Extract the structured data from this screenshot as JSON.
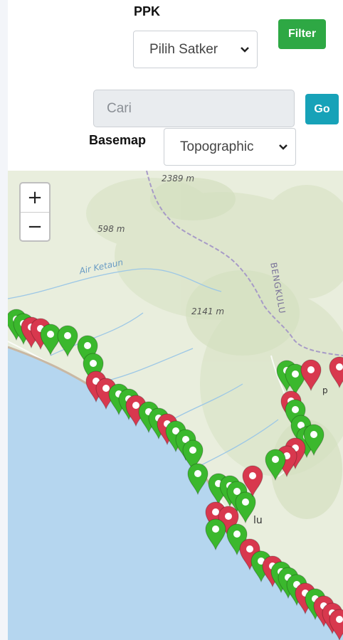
{
  "filter": {
    "ppk_label": "PPK",
    "satker_select_value": "Pilih Satker",
    "filter_button": "Filter"
  },
  "search": {
    "placeholder": "Cari",
    "go_button": "Go"
  },
  "basemap": {
    "label": "Basemap",
    "selected": "Topographic"
  },
  "map": {
    "zoom_in": "+",
    "zoom_out": "−",
    "labels": {
      "elev_1": "2389 m",
      "elev_2": "598 m",
      "elev_3": "2141 m",
      "river": "Air Ketaun",
      "province": "BENGKULU",
      "town_partial_1": "p",
      "town_partial_2": "lu"
    },
    "marker_colors": {
      "green": "#3bb82d",
      "red": "#d8384e"
    }
  },
  "colors": {
    "filter_button": "#2ea844",
    "go_button": "#17a2b8",
    "sea": "#b5d6ef",
    "land": "#e9eedd"
  }
}
